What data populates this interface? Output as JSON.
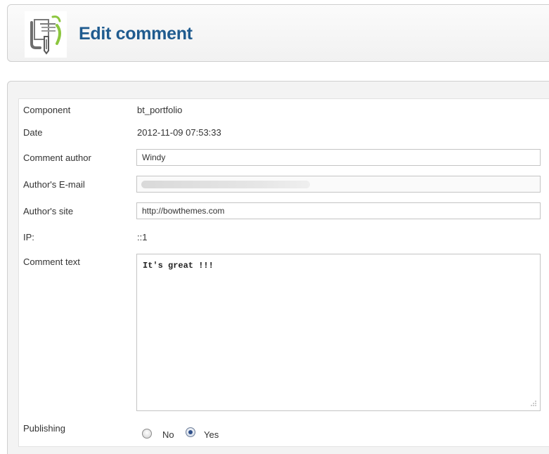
{
  "header": {
    "title": "Edit comment",
    "icon": "comments-document-icon"
  },
  "form": {
    "component": {
      "label": "Component",
      "value": "bt_portfolio"
    },
    "date": {
      "label": "Date",
      "value": "2012-11-09 07:53:33"
    },
    "author": {
      "label": "Comment author",
      "value": "Windy"
    },
    "email": {
      "label": "Author's E-mail",
      "value": ""
    },
    "site": {
      "label": "Author's site",
      "value": "http://bowthemes.com"
    },
    "ip": {
      "label": "IP:",
      "value": "::1"
    },
    "comment": {
      "label": "Comment text",
      "value": "It's great !!!"
    },
    "publishing": {
      "label": "Publishing",
      "options": [
        "No",
        "Yes"
      ],
      "selected": "Yes"
    }
  },
  "colors": {
    "title": "#1f5b8f",
    "icon_green": "#8cc63f",
    "icon_grey": "#6d6d6d"
  }
}
